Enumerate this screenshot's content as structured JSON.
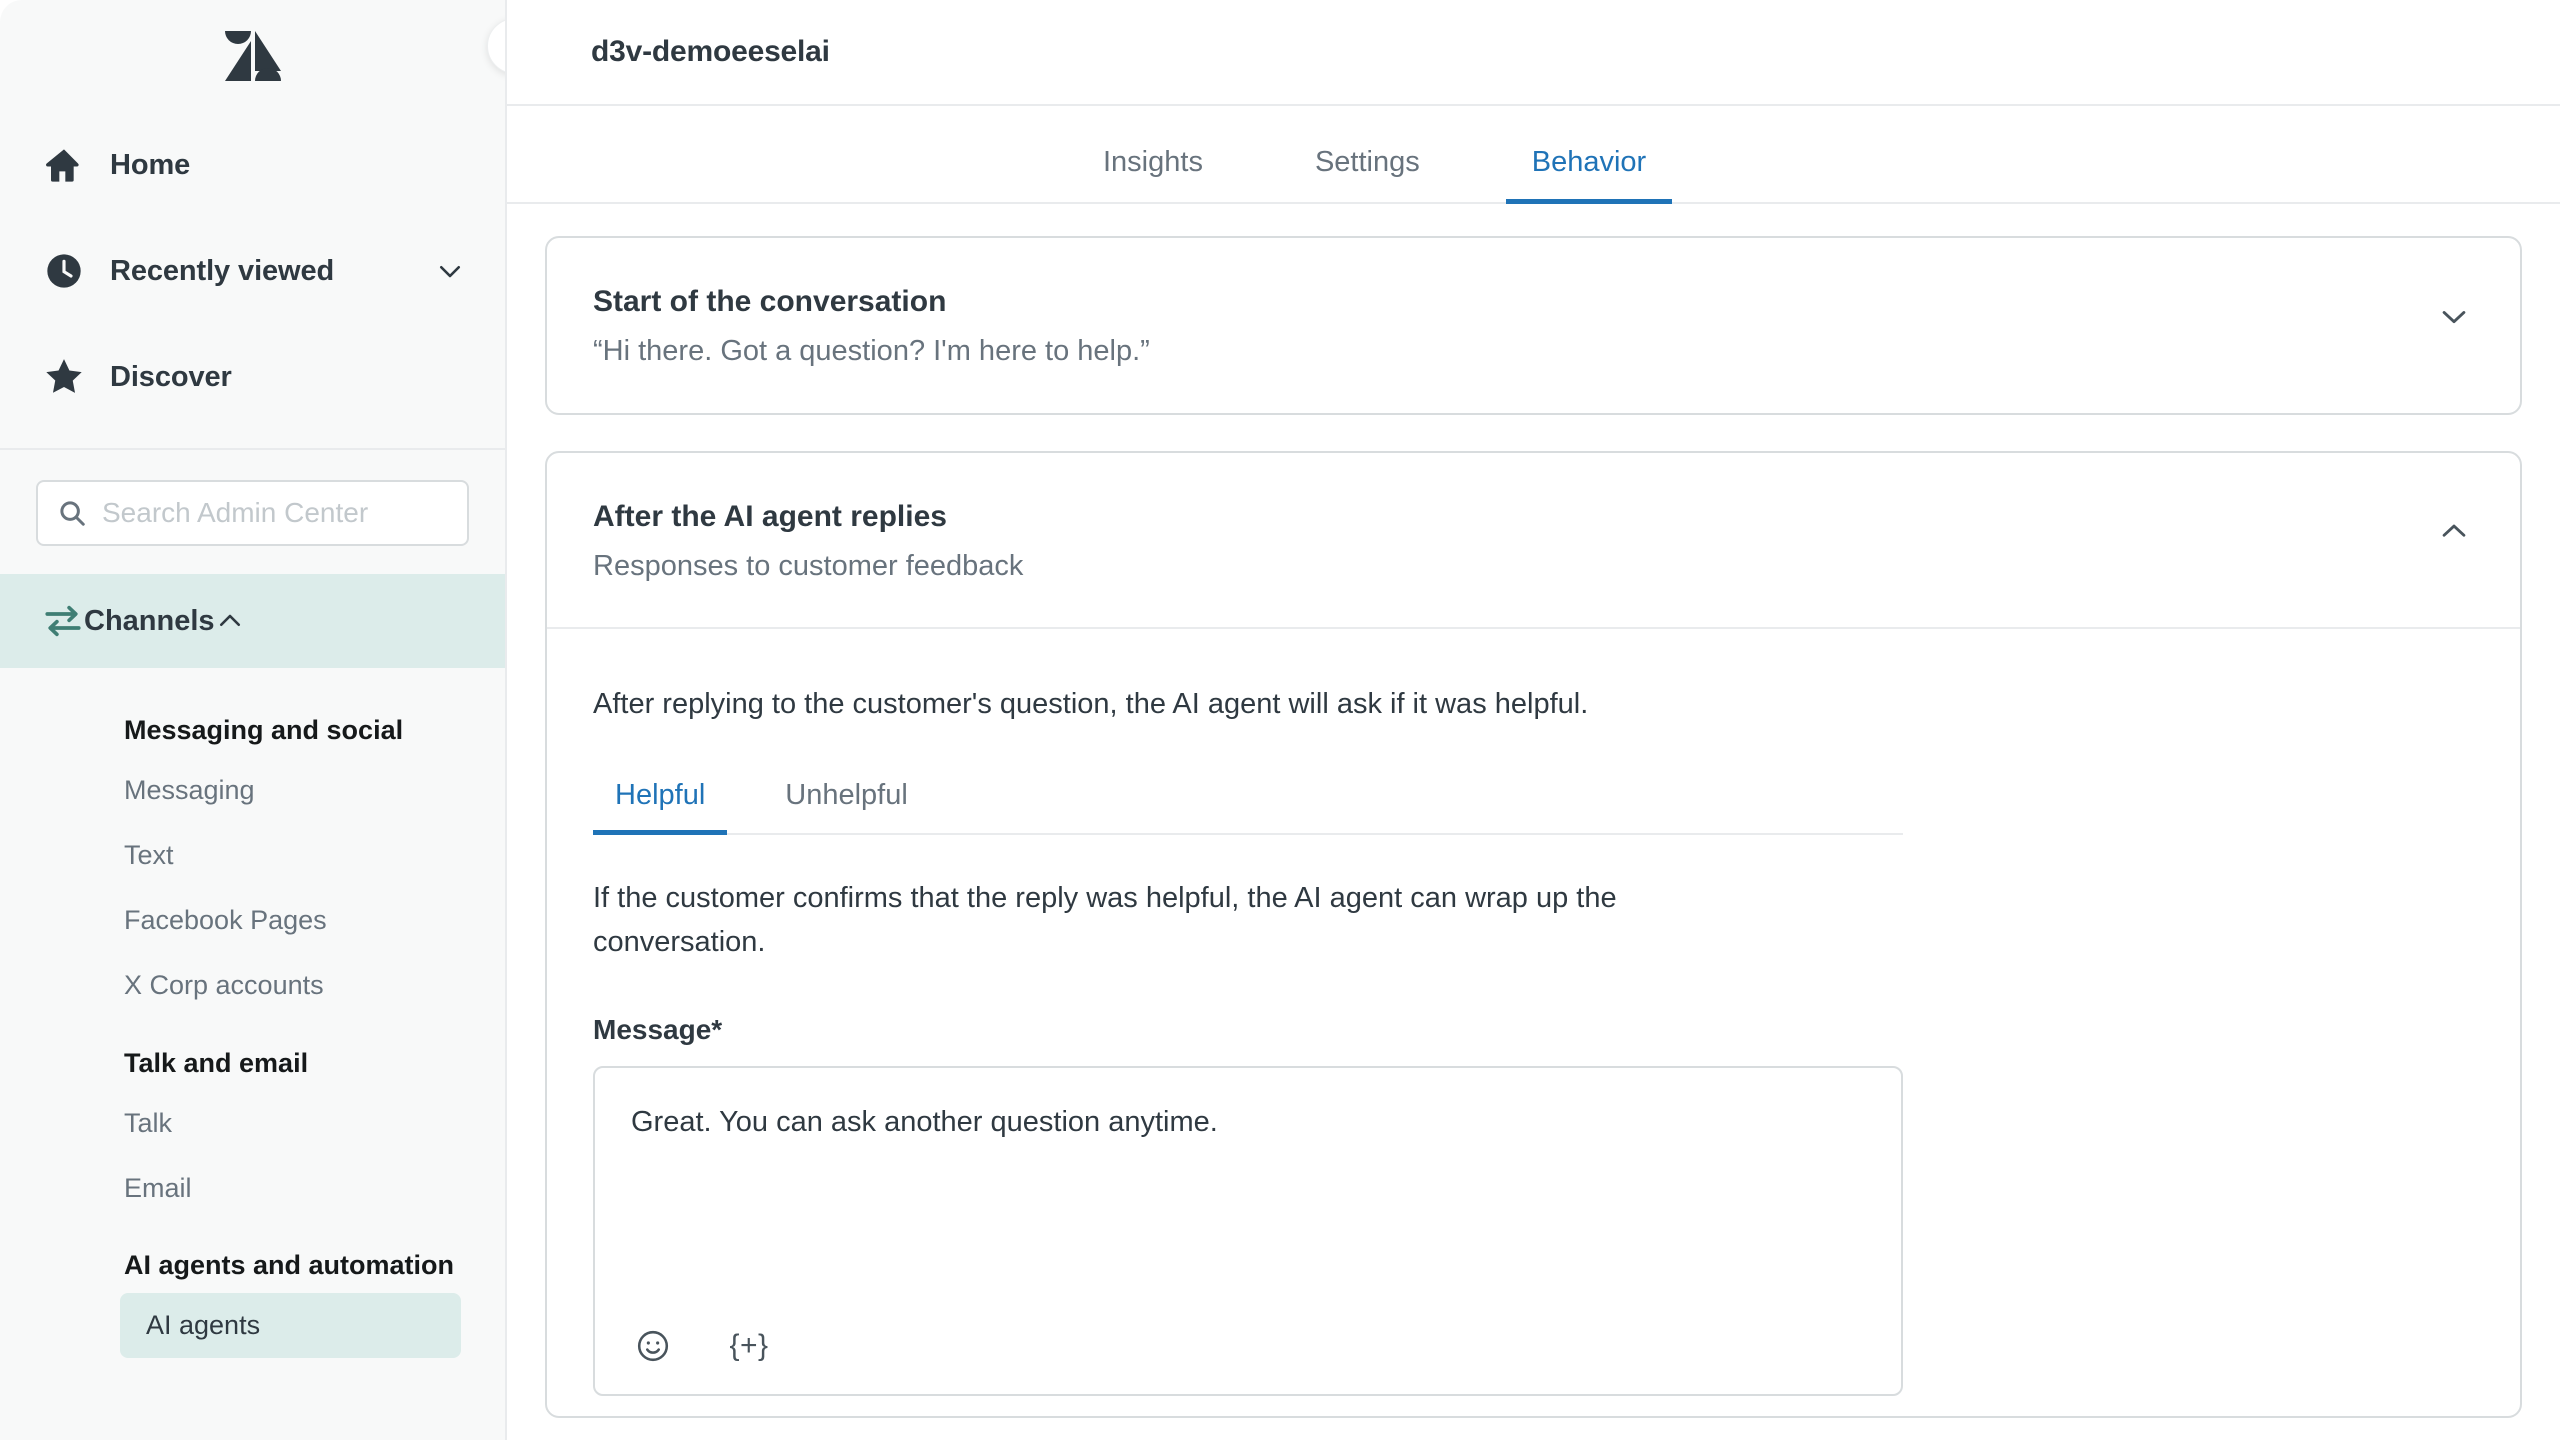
{
  "sidebar": {
    "logo_name": "zendesk-logo",
    "nav": [
      {
        "label": "Home",
        "icon": "home-icon",
        "caret": false
      },
      {
        "label": "Recently viewed",
        "icon": "clock-icon",
        "caret": true
      },
      {
        "label": "Discover",
        "icon": "star-icon",
        "caret": false
      }
    ],
    "search": {
      "placeholder": "Search Admin Center",
      "value": "",
      "icon": "search-icon"
    },
    "section": {
      "label": "Channels",
      "icon": "channels-arrows-icon",
      "caret": "chevron-up-icon",
      "expanded": true,
      "groups": [
        {
          "title": "Messaging and social",
          "items": [
            {
              "label": "Messaging",
              "selected": false
            },
            {
              "label": "Text",
              "selected": false
            },
            {
              "label": "Facebook Pages",
              "selected": false
            },
            {
              "label": "X Corp accounts",
              "selected": false
            }
          ]
        },
        {
          "title": "Talk and email",
          "items": [
            {
              "label": "Talk",
              "selected": false
            },
            {
              "label": "Email",
              "selected": false
            }
          ]
        },
        {
          "title": "AI agents and automation",
          "items": [
            {
              "label": "AI agents",
              "selected": true
            }
          ]
        }
      ]
    },
    "collapse_button": "collapse-sidebar-button"
  },
  "header": {
    "title": "d3v-demoeeselai"
  },
  "tabs": [
    {
      "label": "Insights",
      "active": false
    },
    {
      "label": "Settings",
      "active": false
    },
    {
      "label": "Behavior",
      "active": true
    }
  ],
  "cards": [
    {
      "title": "Start of the conversation",
      "subtitle": "“Hi there. Got a question? I'm here to help.”",
      "caret": "chevron-down-icon",
      "expanded": false
    },
    {
      "title": "After the AI agent replies",
      "subtitle": "Responses to customer feedback",
      "caret": "chevron-up-icon",
      "expanded": true,
      "body": {
        "intro": "After replying to the customer's question, the AI agent will ask if it was helpful.",
        "tabs": [
          {
            "label": "Helpful",
            "active": true
          },
          {
            "label": "Unhelpful",
            "active": false
          }
        ],
        "description": "If the customer confirms that the reply was helpful, the AI agent can wrap up the conversation.",
        "field_label": "Message*",
        "message_value": "Great. You can ask another question anytime.",
        "toolbar": [
          {
            "name": "emoji-icon",
            "glyph": ""
          },
          {
            "name": "placeholder-insert-icon",
            "glyph": "{+}"
          }
        ]
      }
    }
  ],
  "colors": {
    "accent_blue": "#1F73B7",
    "sidebar_bg": "#F8F9F9",
    "selected_teal": "#DCECEA",
    "channels_icon_teal": "#3F7E74",
    "text_primary": "#2F3941",
    "text_muted": "#68737D",
    "border": "#D8DCDE"
  }
}
